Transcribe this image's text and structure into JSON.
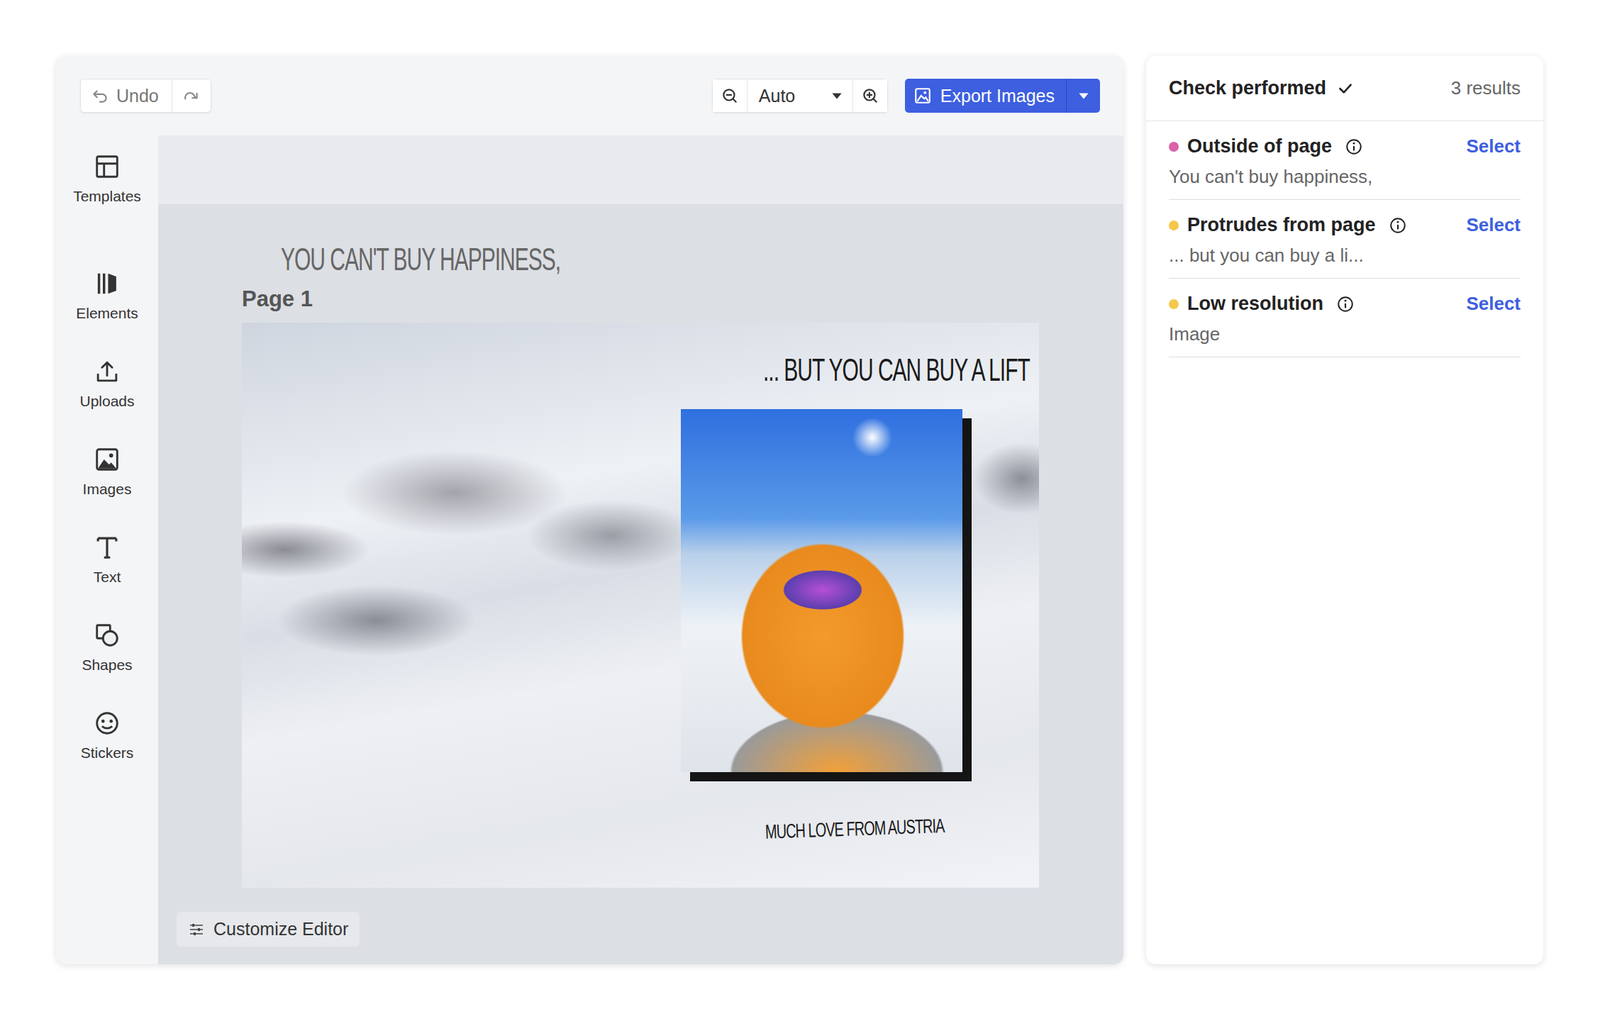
{
  "toolbar": {
    "undo": "Undo",
    "zoom": "Auto",
    "export": "Export Images"
  },
  "sidebar": {
    "items": [
      {
        "label": "Templates"
      },
      {
        "label": "Elements"
      },
      {
        "label": "Uploads"
      },
      {
        "label": "Images"
      },
      {
        "label": "Text"
      },
      {
        "label": "Shapes"
      },
      {
        "label": "Stickers"
      }
    ]
  },
  "canvas": {
    "page_label": "Page 1",
    "texts": [
      {
        "text": "YOU CAN'T BUY HAPPINESS,"
      },
      {
        "text": "... BUT YOU CAN BUY A LIFT"
      },
      {
        "text": "MUCH LOVE FROM AUSTRIA"
      }
    ]
  },
  "customize": "Customize Editor",
  "checks": {
    "title": "Check performed",
    "count": "3 results",
    "results": [
      {
        "type": "Outside of page",
        "detail": "You can't buy happiness,",
        "action": "Select",
        "color": "#d962a8"
      },
      {
        "type": "Protrudes from page",
        "detail": "... but you can buy a li...",
        "action": "Select",
        "color": "#f5c84c"
      },
      {
        "type": "Low resolution",
        "detail": "Image",
        "action": "Select",
        "color": "#f5c84c"
      }
    ]
  }
}
